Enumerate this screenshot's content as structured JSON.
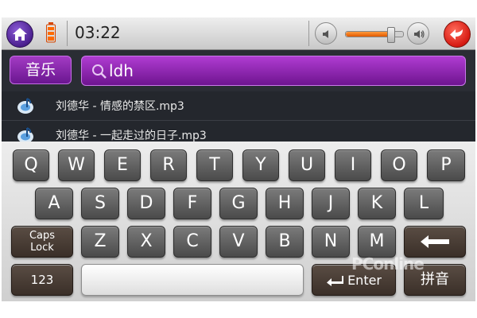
{
  "status_bar": {
    "time": "03:22"
  },
  "search": {
    "category_label": "音乐",
    "query": "ldh"
  },
  "songs": [
    {
      "title": "刘德华 - 情感的禁区.mp3"
    },
    {
      "title": "刘德华 - 一起走过的日子.mp3"
    }
  ],
  "keyboard": {
    "row1": [
      "Q",
      "W",
      "E",
      "R",
      "T",
      "Y",
      "U",
      "I",
      "O",
      "P"
    ],
    "row2": [
      "A",
      "S",
      "D",
      "F",
      "G",
      "H",
      "J",
      "K",
      "L"
    ],
    "row3": [
      "Z",
      "X",
      "C",
      "V",
      "B",
      "N",
      "M"
    ],
    "caps_label_line1": "Caps",
    "caps_label_line2": "Lock",
    "numbers_label": "123",
    "enter_label": "Enter",
    "pinyin_label": "拼音"
  },
  "watermark": "PConline",
  "colors": {
    "accent_purple": "#8e2bb5",
    "back_red": "#d61a12",
    "volume_orange": "#ff7a1a"
  },
  "icons": {
    "home": "home-icon",
    "battery": "battery-icon",
    "volume_down": "volume-down-icon",
    "volume_up": "volume-up-icon",
    "back": "back-arrow-icon",
    "search": "search-icon",
    "music_note": "music-note-icon",
    "backspace": "backspace-arrow-icon",
    "enter": "enter-arrow-icon"
  },
  "volume_level": 0.78
}
